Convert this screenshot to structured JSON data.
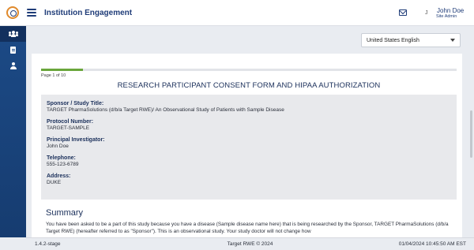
{
  "header": {
    "app_title": "Institution Engagement",
    "logo_icon": "target-logo-icon",
    "menu_icon": "hamburger-menu-icon",
    "mail_icon": "mail-icon",
    "separator": "J",
    "user_name": "John Doe",
    "user_role": "Site Admin"
  },
  "sidebar": {
    "items": [
      {
        "icon": "users-icon",
        "active": true
      },
      {
        "icon": "document-icon",
        "active": false
      },
      {
        "icon": "user-icon",
        "active": false
      }
    ]
  },
  "language": {
    "selected": "United States English"
  },
  "form": {
    "progress_percent": 10,
    "page_indicator": "Page 1 of 10",
    "title": "RESEARCH PARTICIPANT CONSENT FORM AND HIPAA AUTHORIZATION",
    "fields": [
      {
        "label": "Sponsor / Study Title:",
        "value": "TARGET PharmaSolutions (d/b/a Target RWE)/ An Observational Study of Patients with Sample Disease"
      },
      {
        "label": "Protocol Number:",
        "value": "TARGET-SAMPLE"
      },
      {
        "label": "Principal Investigator:",
        "value": "John Doe"
      },
      {
        "label": "Telephone:",
        "value": "555-123-6789"
      },
      {
        "label": "Address:",
        "value": "DUKE"
      }
    ],
    "summary_title": "Summary",
    "summary_text": "You have been asked to be a part of this study because you have a disease (Sample disease name here) that is being researched by the Sponsor, TARGET PharmaSolutions (d/b/a Target RWE) (hereafter referred to as \"Sponsor\"). This is an observational study. Your study doctor will not change how"
  },
  "footer": {
    "version": "1.4.2-stage",
    "copyright": "Target RWE © 2024",
    "datetime": "01/04/2024 10:45:50 AM EST"
  }
}
